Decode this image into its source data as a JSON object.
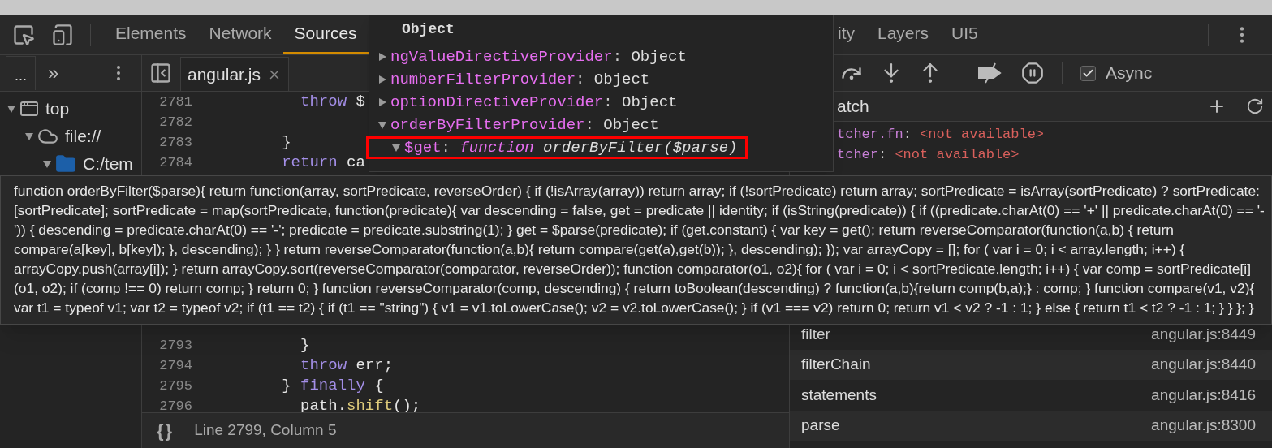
{
  "panel_tabs": [
    {
      "label": "Elements",
      "selected": false
    },
    {
      "label": "Network",
      "selected": false
    },
    {
      "label": "Sources",
      "selected": true
    }
  ],
  "more_tabs": [
    {
      "label": "ity",
      "selected": false
    },
    {
      "label": "Layers",
      "selected": false
    },
    {
      "label": "UI5",
      "selected": false
    }
  ],
  "navigator": {
    "overflow_tab": "...",
    "chevron": "»",
    "tree": [
      {
        "label": "top",
        "kind": "frame",
        "expanded": true,
        "children": [
          {
            "label": "file://",
            "kind": "origin",
            "expanded": true,
            "children": [
              {
                "label": "C:/tem",
                "kind": "folder",
                "expanded": true
              }
            ]
          }
        ]
      }
    ]
  },
  "editor": {
    "file_tab": {
      "label": "angular.js",
      "selected": true
    },
    "lines": [
      {
        "number": "2781",
        "tokens": [
          {
            "text": "          throw",
            "kind": "keyword"
          },
          {
            "text": " $",
            "kind": "plain"
          }
        ]
      },
      {
        "number": "2782"
      },
      {
        "number": "2783",
        "tokens": [
          {
            "text": "        }",
            "kind": "plain"
          }
        ]
      },
      {
        "number": "2784",
        "tokens": [
          {
            "text": "        return",
            "kind": "keyword"
          },
          {
            "text": " ca",
            "kind": "plain"
          }
        ]
      }
    ],
    "lines_lower": [
      {
        "number": "2793",
        "tokens": [
          {
            "text": "          }",
            "kind": "plain"
          }
        ]
      },
      {
        "number": "2794",
        "tokens": [
          {
            "text": "          throw",
            "kind": "keyword"
          },
          {
            "text": " err;",
            "kind": "plain"
          }
        ]
      },
      {
        "number": "2795",
        "tokens": [
          {
            "text": "        } ",
            "kind": "plain"
          },
          {
            "text": "finally",
            "kind": "keyword"
          },
          {
            "text": " {",
            "kind": "plain"
          }
        ]
      },
      {
        "number": "2796",
        "tokens": [
          {
            "text": "          path.",
            "kind": "plain"
          },
          {
            "text": "shift",
            "kind": "method"
          },
          {
            "text": "();",
            "kind": "plain"
          }
        ]
      }
    ]
  },
  "status_bar": {
    "format_glyph": "{}",
    "position": "Line 2799, Column 5"
  },
  "debugger": {
    "async": {
      "label": "Async",
      "checked": true
    },
    "watch": {
      "title": "atch",
      "separator": ":",
      "entries": [
        {
          "name": "tcher.fn",
          "value": "<not available>"
        },
        {
          "name": "tcher",
          "value": "<not available>"
        }
      ]
    },
    "call_stack": [
      {
        "function": "filter",
        "location": "angular.js:8449"
      },
      {
        "function": "filterChain",
        "location": "angular.js:8440"
      },
      {
        "function": "statements",
        "location": "angular.js:8416"
      },
      {
        "function": "parse",
        "location": "angular.js:8300"
      }
    ]
  },
  "popover": {
    "title": "Object",
    "separator": ":",
    "properties": [
      {
        "name": "ngValueDirectiveProvider",
        "value": "Object",
        "expanded": false
      },
      {
        "name": "numberFilterProvider",
        "value": "Object",
        "expanded": false
      },
      {
        "name": "optionDirectiveProvider",
        "value": "Object",
        "expanded": false
      },
      {
        "name": "orderByFilterProvider",
        "value": "Object",
        "expanded": true,
        "children": [
          {
            "name": "$get",
            "kind": "function",
            "keyword": "function",
            "value": "orderByFilter($parse)",
            "expanded": true,
            "highlighted": true
          }
        ]
      }
    ]
  },
  "tooltip": {
    "text": "function orderByFilter($parse){ return function(array, sortPredicate, reverseOrder) { if (!isArray(array)) return array; if (!sortPredicate) return array; sortPredicate = isArray(sortPredicate) ? sortPredicate: [sortPredicate]; sortPredicate = map(sortPredicate, function(predicate){ var descending = false, get = predicate || identity; if (isString(predicate)) { if ((predicate.charAt(0) == '+' || predicate.charAt(0) == '-')) { descending = predicate.charAt(0) == '-'; predicate = predicate.substring(1); } get = $parse(predicate); if (get.constant) { var key = get(); return reverseComparator(function(a,b) { return compare(a[key], b[key]); }, descending); } } return reverseComparator(function(a,b){ return compare(get(a),get(b)); }, descending); }); var arrayCopy = []; for ( var i = 0; i < array.length; i++) { arrayCopy.push(array[i]); } return arrayCopy.sort(reverseComparator(comparator, reverseOrder)); function comparator(o1, o2){ for ( var i = 0; i < sortPredicate.length; i++) { var comp = sortPredicate[i](o1, o2); if (comp !== 0) return comp; } return 0; } function reverseComparator(comp, descending) { return toBoolean(descending) ? function(a,b){return comp(b,a);} : comp; } function compare(v1, v2){ var t1 = typeof v1; var t2 = typeof v2; if (t1 == t2) { if (t1 == \"string\") { v1 = v1.toLowerCase(); v2 = v2.toLowerCase(); } if (v1 === v2) return 0; return v1 < v2 ? -1 : 1; } else { return t1 < t2 ? -1 : 1; } } }; }"
  }
}
